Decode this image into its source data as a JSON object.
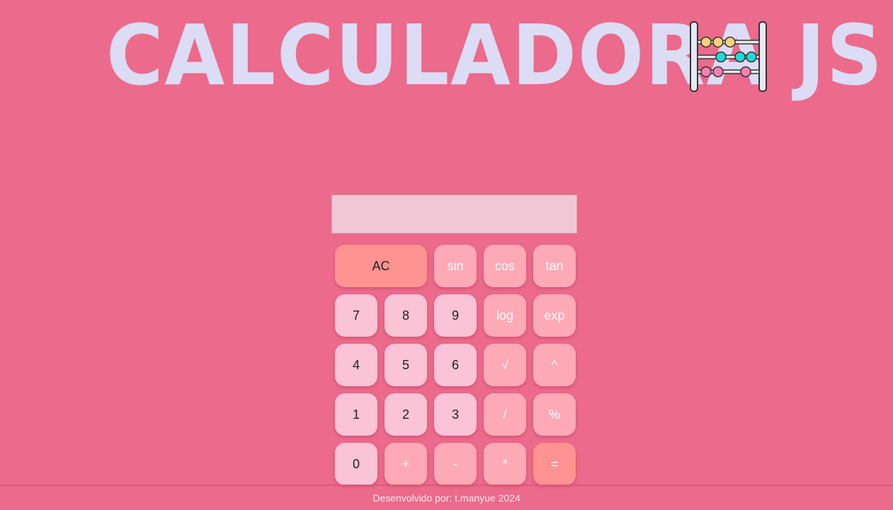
{
  "header": {
    "title": "CALCULADORA JS",
    "logo_icon": "abacus-icon"
  },
  "calculator": {
    "display_value": "",
    "keys": {
      "ac": "AC",
      "sin": "sin",
      "cos": "cos",
      "tan": "tan",
      "seven": "7",
      "eight": "8",
      "nine": "9",
      "log": "log",
      "exp": "exp",
      "four": "4",
      "five": "5",
      "six": "6",
      "sqrt": "√",
      "pow": "^",
      "one": "1",
      "two": "2",
      "three": "3",
      "divide": "/",
      "percent": "%",
      "zero": "0",
      "plus": "+",
      "minus": "-",
      "multiply": "*",
      "equals": "="
    }
  },
  "footer": {
    "text": "Desenvolvido por: t.manyue 2024"
  },
  "colors": {
    "background": "#ec6a8b",
    "title": "#dcdcf5",
    "display": "#f2c8d6",
    "number_key": "#fac3d6",
    "function_key": "#fea9b6",
    "accent_key": "#fe9391"
  }
}
